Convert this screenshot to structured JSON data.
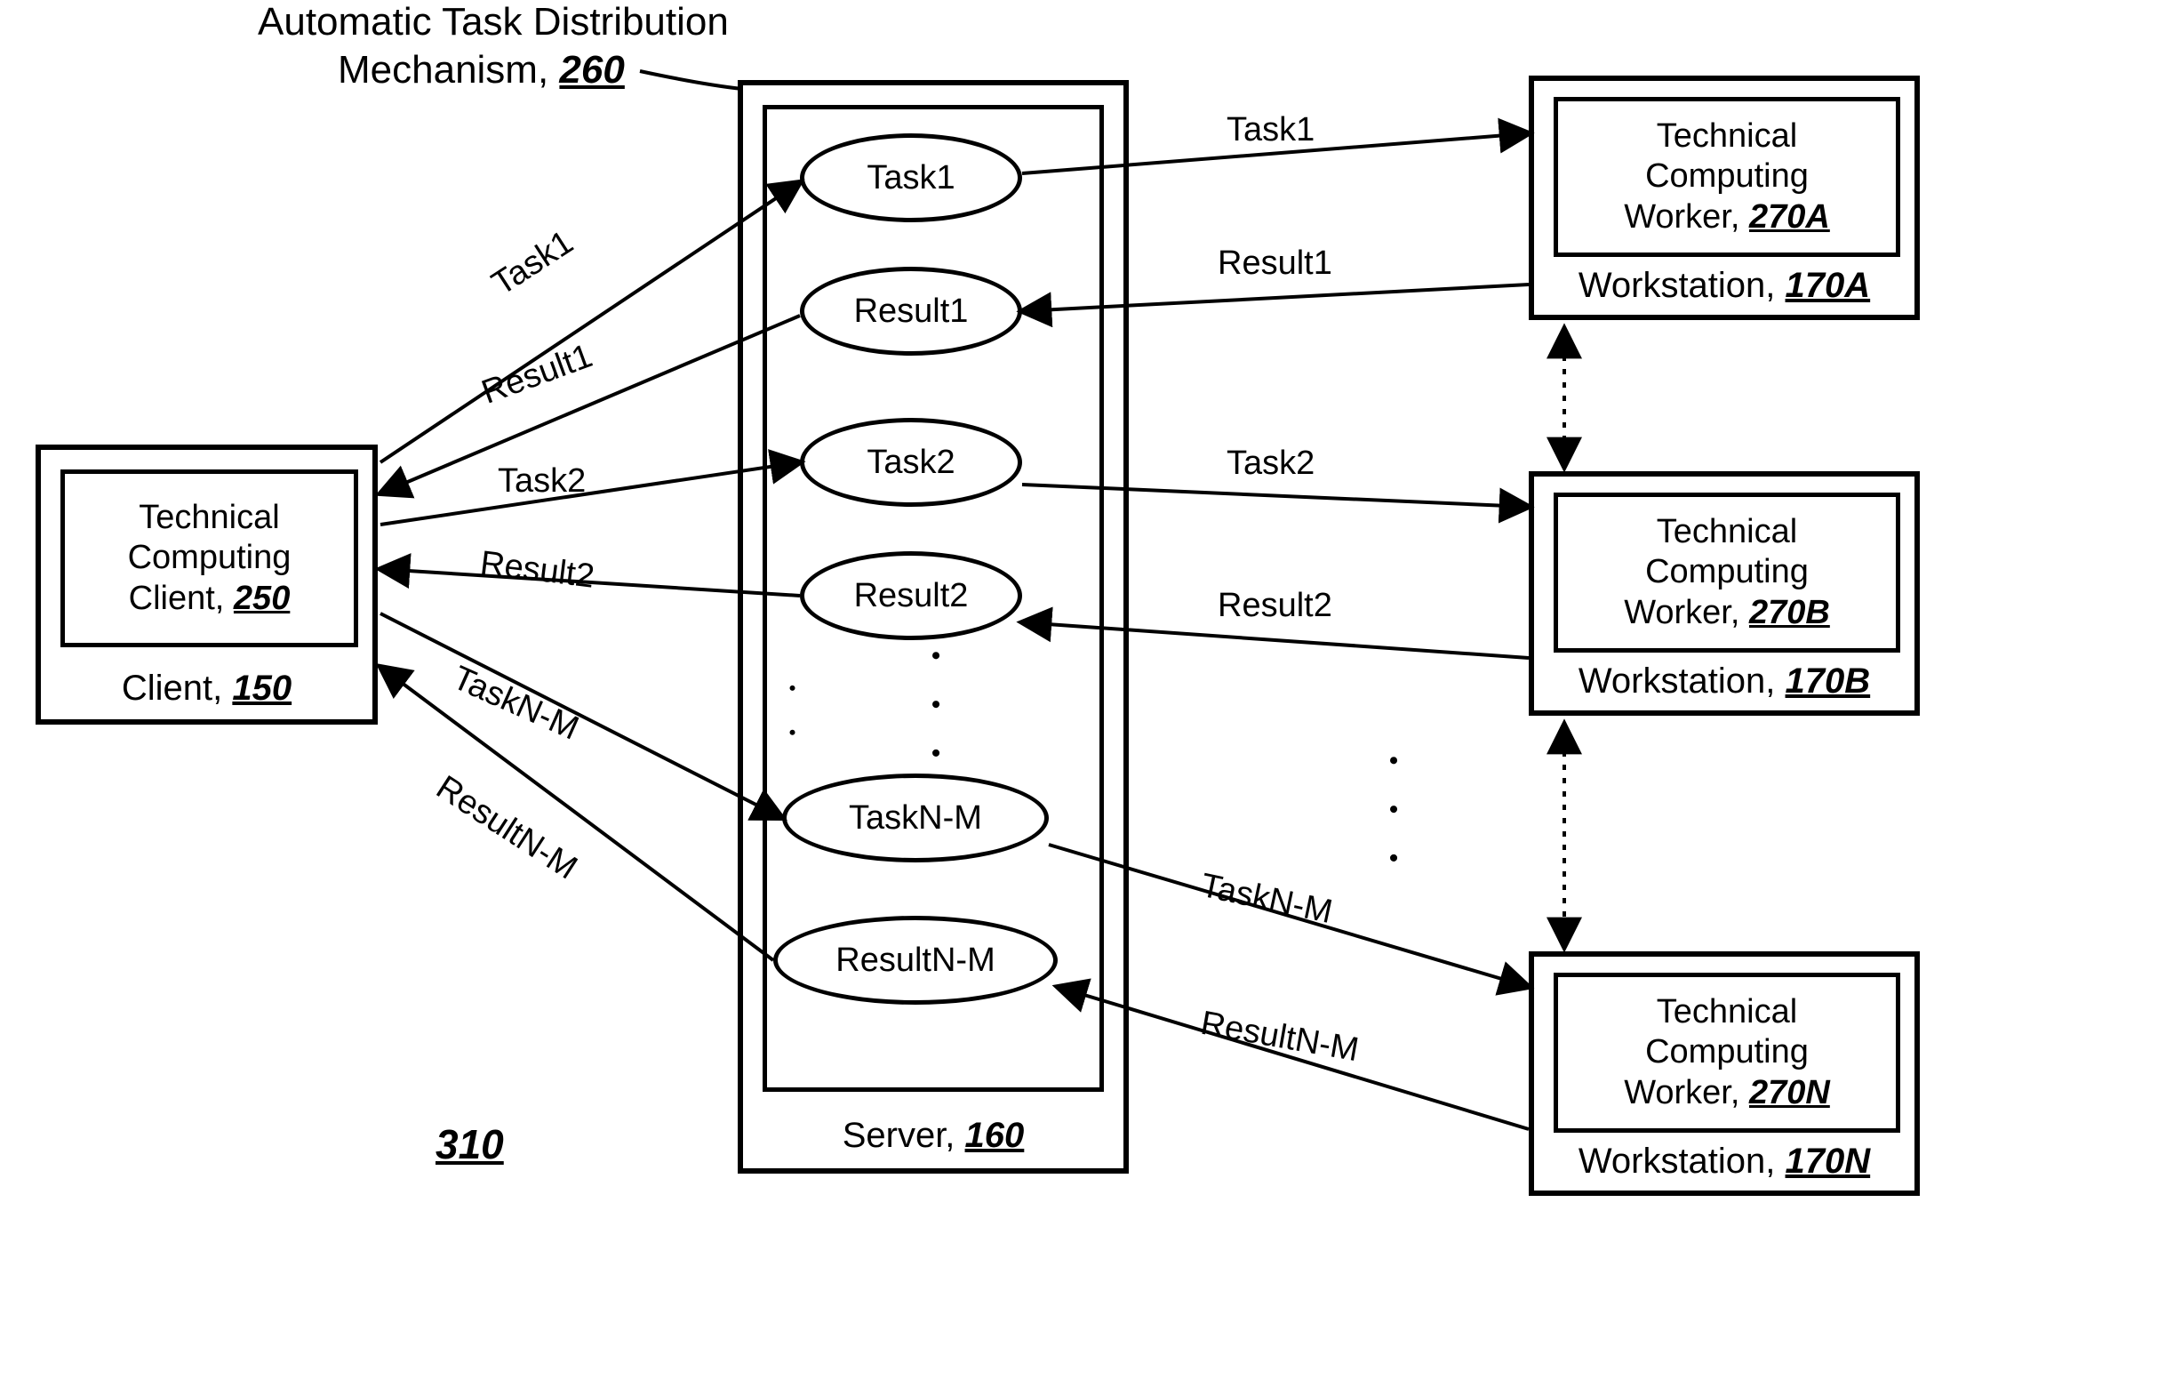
{
  "title": {
    "line1": "Automatic Task Distribution",
    "line2prefix": "Mechanism, ",
    "line2num": "260"
  },
  "client": {
    "inner_line1": "Technical",
    "inner_line2": "Computing",
    "inner_line3prefix": "Client, ",
    "inner_line3num": "250",
    "footer_prefix": "Client, ",
    "footer_num": "150"
  },
  "server": {
    "footer_prefix": "Server, ",
    "footer_num": "160",
    "ellipses": {
      "task1": "Task1",
      "result1": "Result1",
      "task2": "Task2",
      "result2": "Result2",
      "tasknm": "TaskN-M",
      "resultnm": "ResultN-M"
    }
  },
  "workers": {
    "a": {
      "inner_line1": "Technical",
      "inner_line2": "Computing",
      "inner_line3prefix": "Worker, ",
      "inner_line3num": "270A",
      "footer_prefix": "Workstation, ",
      "footer_num": "170A"
    },
    "b": {
      "inner_line1": "Technical",
      "inner_line2": "Computing",
      "inner_line3prefix": "Worker, ",
      "inner_line3num": "270B",
      "footer_prefix": "Workstation, ",
      "footer_num": "170B"
    },
    "n": {
      "inner_line1": "Technical",
      "inner_line2": "Computing",
      "inner_line3prefix": "Worker, ",
      "inner_line3num": "270N",
      "footer_prefix": "Workstation, ",
      "footer_num": "170N"
    }
  },
  "arrow_labels": {
    "c_task1": "Task1",
    "c_result1": "Result1",
    "c_task2": "Task2",
    "c_result2": "Result2",
    "c_tasknm": "TaskN-M",
    "c_resultnm": "ResultN-M",
    "w_task1": "Task1",
    "w_result1": "Result1",
    "w_task2": "Task2",
    "w_result2": "Result2",
    "w_tasknm": "TaskN-M",
    "w_resultnm": "ResultN-M"
  },
  "figure_num": "310"
}
